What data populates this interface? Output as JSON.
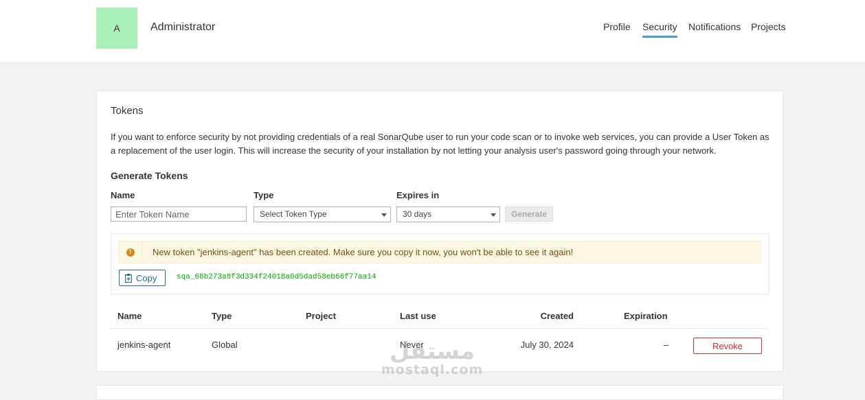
{
  "header": {
    "avatar_letter": "A",
    "username": "Administrator",
    "nav": [
      {
        "label": "Profile",
        "active": false
      },
      {
        "label": "Security",
        "active": true
      },
      {
        "label": "Notifications",
        "active": false
      },
      {
        "label": "Projects",
        "active": false
      }
    ],
    "accent_color": "#4b9fd5",
    "avatar_color": "#aaf0b9"
  },
  "tokens": {
    "title": "Tokens",
    "description": "If you want to enforce security by not providing credentials of a real SonarQube user to run your code scan or to invoke web services, you can provide a User Token as a replacement of the user login. This will increase the security of your installation by not letting your analysis user's password going through your network.",
    "generate": {
      "title": "Generate Tokens",
      "name_label": "Name",
      "name_placeholder": "Enter Token Name",
      "name_value": "",
      "type_label": "Type",
      "type_value": "Select Token Type",
      "expires_label": "Expires in",
      "expires_value": "30 days",
      "generate_button": "Generate"
    },
    "created": {
      "message": "New token \"jenkins-agent\" has been created. Make sure you copy it now, you won't be able to see it again!",
      "alert_icon": "exclamation-circle-icon",
      "copy_button": "Copy",
      "token_value": "sqa_68b273a8f3d334f24018a0d5dad58eb66f77aa14"
    },
    "table": {
      "headers": {
        "name": "Name",
        "type": "Type",
        "project": "Project",
        "last_use": "Last use",
        "created": "Created",
        "expiration": "Expiration"
      },
      "rows": [
        {
          "name": "jenkins-agent",
          "type": "Global",
          "project": "",
          "last_use": "Never",
          "created": "July 30, 2024",
          "expiration": "–",
          "action": "Revoke"
        }
      ]
    }
  },
  "watermark": {
    "arabic": "مستقل",
    "latin": "mostaql.com"
  }
}
